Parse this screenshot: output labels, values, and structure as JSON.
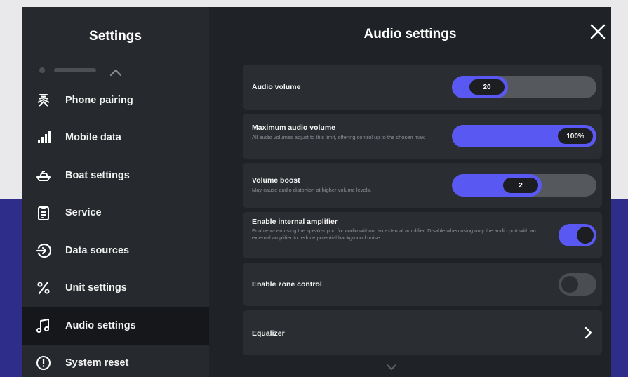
{
  "sidebar": {
    "title": "Settings",
    "items": [
      {
        "label": "Phone pairing",
        "icon": "phone-pairing-icon",
        "active": false
      },
      {
        "label": "Mobile data",
        "icon": "signal-bars-icon",
        "active": false
      },
      {
        "label": "Boat settings",
        "icon": "boat-icon",
        "active": false
      },
      {
        "label": "Service",
        "icon": "clipboard-icon",
        "active": false
      },
      {
        "label": "Data sources",
        "icon": "data-source-icon",
        "active": false
      },
      {
        "label": "Unit settings",
        "icon": "percent-icon",
        "active": false
      },
      {
        "label": "Audio settings",
        "icon": "music-note-icon",
        "active": true
      },
      {
        "label": "System reset",
        "icon": "alert-circle-icon",
        "active": false
      }
    ]
  },
  "main": {
    "title": "Audio settings",
    "audio_volume": {
      "title": "Audio volume",
      "value": "20",
      "level_fraction": 0.33
    },
    "max_volume": {
      "title": "Maximum audio volume",
      "description": "All audio volumes adjust to this limit, offering control up to the chosen max.",
      "value": "100%",
      "level_fraction": 1.0
    },
    "volume_boost": {
      "title": "Volume boost",
      "description": "May cause audio distortion at higher volume levels.",
      "value": "2",
      "level_fraction": 0.62
    },
    "internal_amp": {
      "title": "Enable internal amplifier",
      "description": "Enable when using the speaker port for audio without an external amplifier. Disable when using only the audio port with an external amplifier to reduce potential background noise.",
      "enabled": true
    },
    "zone_control": {
      "title": "Enable zone control",
      "enabled": false
    },
    "equalizer": {
      "title": "Equalizer"
    }
  },
  "colors": {
    "accent": "#5a58f2",
    "panel": "#1f2226",
    "row": "#2a2d31",
    "sidebar": "#26292d",
    "active_nav": "#15171a",
    "band": "#2f2d8a"
  }
}
